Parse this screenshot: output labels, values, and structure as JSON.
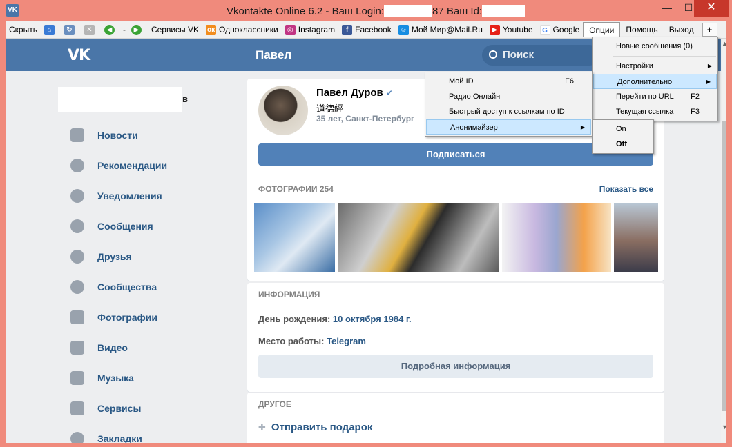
{
  "window": {
    "title": "Vkontakte Online 6.2 - Ваш Login:",
    "title_mid": "Ваш Id:",
    "title_frag": "87",
    "min": "—",
    "max": "☐",
    "close": "✕"
  },
  "toolbar": {
    "hide": "Скрыть",
    "sep": "-",
    "services": "Сервисы VK",
    "bookmarks": [
      {
        "label": "Одноклассники",
        "icon": "odnoklassniki-icon",
        "color": "#f28d1e"
      },
      {
        "label": "Instagram",
        "icon": "instagram-icon",
        "color": "#c13584"
      },
      {
        "label": "Facebook",
        "icon": "facebook-icon",
        "color": "#3b5998"
      },
      {
        "label": "Мой Мир@Mail.Ru",
        "icon": "mailru-icon",
        "color": "#168de2"
      },
      {
        "label": "Youtube",
        "icon": "youtube-icon",
        "color": "#e62117"
      },
      {
        "label": "Google",
        "icon": "google-icon",
        "color": "#4285f4"
      }
    ],
    "menus": [
      "Опции",
      "Помощь",
      "Выход"
    ],
    "plus": "+"
  },
  "vk": {
    "logo": "VK",
    "header_title": "Павел",
    "search_placeholder": "Поиск",
    "nav": [
      "Новости",
      "Рекомендации",
      "Уведомления",
      "Сообщения",
      "Друзья",
      "Сообщества",
      "Фотографии",
      "Видео",
      "Музыка",
      "Сервисы",
      "Закладки"
    ],
    "user_frag": "в"
  },
  "profile": {
    "name": "Павел Дуров",
    "verified": "✔",
    "status": "道德經",
    "info": "35 лет, Санкт-Петербург",
    "subscribe": "Подписаться",
    "photos_head": "ФОТОГРАФИИ 254",
    "show_all": "Показать все",
    "info_head": "ИНФОРМАЦИЯ",
    "birthday_label": "День рождения:",
    "birthday_value": "10 октября 1984 г.",
    "work_label": "Место работы:",
    "work_value": "Telegram",
    "details_btn": "Подробная информация",
    "other_head": "ДРУГОЕ",
    "gift": "Отправить подарок"
  },
  "menu_main": {
    "new_messages": "Новые сообщения (0)",
    "settings": "Настройки",
    "advanced": "Дополнительно",
    "goto_url": "Перейти по URL",
    "goto_url_sc": "F2",
    "current_link": "Текущая ссылка",
    "current_link_sc": "F3"
  },
  "menu_sub": {
    "my_id": "Мой ID",
    "my_id_sc": "F6",
    "radio": "Радио Онлайн",
    "quick_access": "Быстрый доступ к ссылкам по ID",
    "anonymizer": "Анонимайзер"
  },
  "menu_anon": {
    "on": "On",
    "off": "Off"
  },
  "colors": {
    "frame": "#f08a7c",
    "vk_blue": "#4a76a8",
    "link": "#2a5885"
  }
}
